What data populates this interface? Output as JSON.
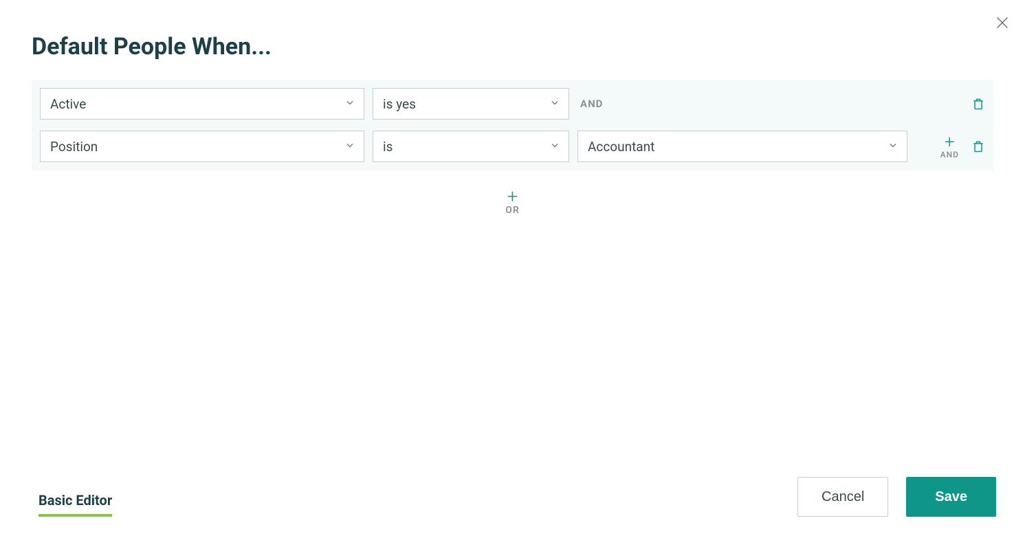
{
  "title": "Default People When...",
  "filter_group": {
    "rows": [
      {
        "field": "Active",
        "operator": "is yes",
        "value": null,
        "conjunction_after": "AND"
      },
      {
        "field": "Position",
        "operator": "is",
        "value": "Accountant",
        "conjunction_after": null
      }
    ],
    "add_and_label": "AND"
  },
  "add_or_label": "OR",
  "footer": {
    "editor_link": "Basic Editor",
    "cancel_label": "Cancel",
    "save_label": "Save"
  },
  "icons": {
    "close": "close-icon",
    "chevron_down": "chevron-down-icon",
    "plus": "plus-icon",
    "trash": "trash-icon"
  },
  "colors": {
    "accent_teal": "#0e9688",
    "accent_green": "#8bc34a",
    "title_color": "#1d3f48",
    "muted_text": "#8a9396",
    "border": "#c5cdd0",
    "group_bg": "#f4f9fa"
  }
}
